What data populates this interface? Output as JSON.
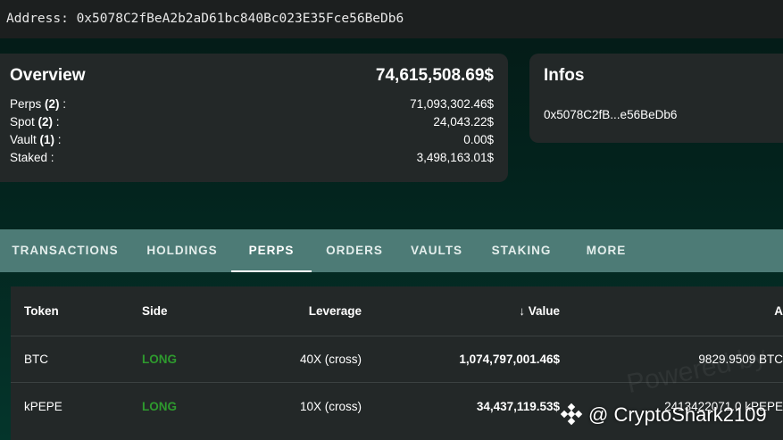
{
  "address": {
    "label": "Address:",
    "value": "0x5078C2fBeA2b2aD61bc840Bc023E35Fce56BeDb6"
  },
  "overview": {
    "title": "Overview",
    "total": "74,615,508.69$",
    "rows": [
      {
        "name": "Perps",
        "count": "(2)",
        "value": "71,093,302.46$"
      },
      {
        "name": "Spot",
        "count": "(2)",
        "value": "24,043.22$"
      },
      {
        "name": "Vault",
        "count": "(1)",
        "value": "0.00$"
      },
      {
        "name": "Staked",
        "count": "",
        "value": "3,498,163.01$"
      }
    ]
  },
  "infos": {
    "title": "Infos",
    "address_short": "0x5078C2fB...e56BeDb6"
  },
  "tabs": [
    {
      "label": "TRANSACTIONS",
      "active": false
    },
    {
      "label": "HOLDINGS",
      "active": false
    },
    {
      "label": "PERPS",
      "active": true
    },
    {
      "label": "ORDERS",
      "active": false
    },
    {
      "label": "VAULTS",
      "active": false
    },
    {
      "label": "STAKING",
      "active": false
    },
    {
      "label": "MORE",
      "active": false
    }
  ],
  "table": {
    "headers": {
      "token": "Token",
      "side": "Side",
      "leverage": "Leverage",
      "value_sort_icon": "↓",
      "value": "Value",
      "amount": "A"
    },
    "rows": [
      {
        "token": "BTC",
        "side": "LONG",
        "leverage": "40X (cross)",
        "value": "1,074,797,001.46$",
        "amount": "9829.9509 BTC"
      },
      {
        "token": "kPEPE",
        "side": "LONG",
        "leverage": "10X (cross)",
        "value": "34,437,119.53$",
        "amount": "2413422071.0 kPEPE"
      }
    ]
  },
  "overlay": {
    "watermark": "Powered by",
    "credit": "@ CryptoShark2109",
    "credit_icon": "binance-logo-icon"
  },
  "colors": {
    "long": "#2e9a2e",
    "tab_bar": "#4d7b76",
    "card": "#232828"
  }
}
